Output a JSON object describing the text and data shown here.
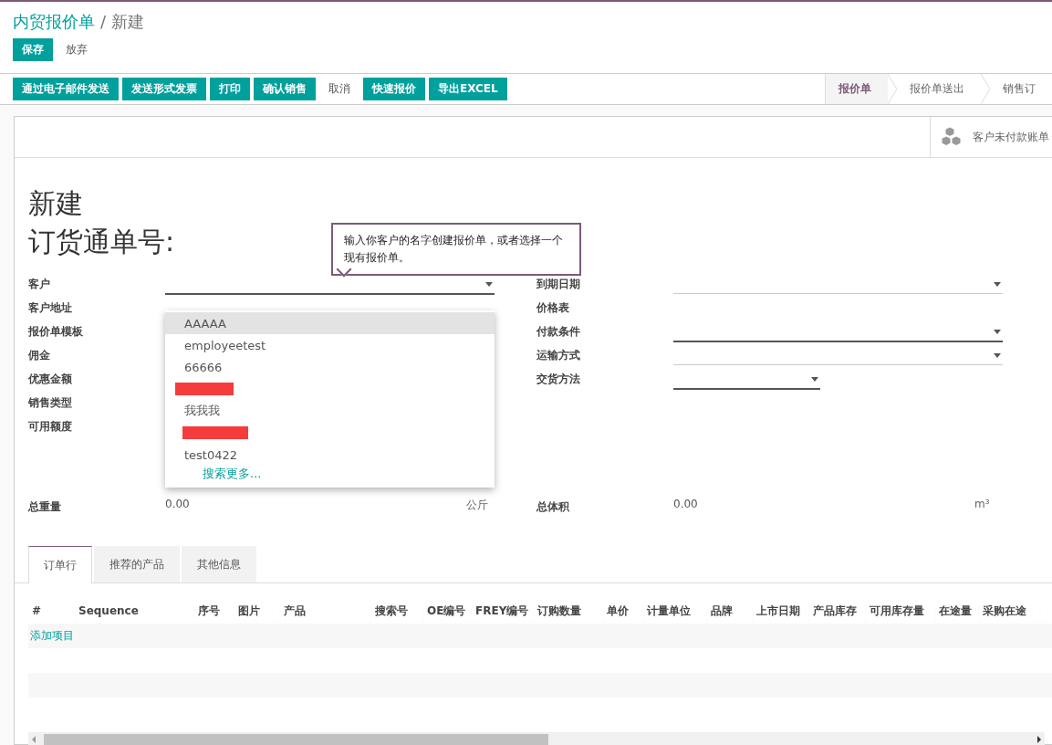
{
  "breadcrumb": {
    "parent": "内贸报价单",
    "separator": "/",
    "current": "新建"
  },
  "edit_buttons": [
    {
      "label": "保存",
      "kind": "primary"
    },
    {
      "label": "放弃",
      "kind": "link"
    }
  ],
  "action_buttons": [
    {
      "label": "通过电子邮件发送",
      "kind": "primary"
    },
    {
      "label": "发送形式发票",
      "kind": "primary"
    },
    {
      "label": "打印",
      "kind": "primary"
    },
    {
      "label": "确认销售",
      "kind": "primary"
    },
    {
      "label": "取消",
      "kind": "link"
    },
    {
      "label": "快速报价",
      "kind": "primary"
    },
    {
      "label": "导出EXCEL",
      "kind": "primary"
    }
  ],
  "status_steps": [
    {
      "label": "报价单",
      "selected": true
    },
    {
      "label": "报价单送出",
      "selected": false
    },
    {
      "label": "销售订",
      "selected": false
    }
  ],
  "stat_button": {
    "label": "客户未付款账单"
  },
  "title": "新建",
  "subtitle": "订货通单号:",
  "tooltip": "输入你客户的名字创建报价单，或者选择一个现有报价单。",
  "left_fields": [
    {
      "label": "客户",
      "kind": "select",
      "required": true
    },
    {
      "label": "客户地址",
      "kind": "none"
    },
    {
      "label": "报价单模板",
      "kind": "none"
    },
    {
      "label": "佣金",
      "kind": "none"
    },
    {
      "label": "优惠金额",
      "kind": "none"
    },
    {
      "label": "销售类型",
      "kind": "none"
    },
    {
      "label": "可用额度",
      "kind": "none"
    }
  ],
  "right_fields": [
    {
      "label": "到期日期",
      "kind": "select",
      "required": false
    },
    {
      "label": "价格表",
      "kind": "none"
    },
    {
      "label": "付款条件",
      "kind": "select",
      "required": true
    },
    {
      "label": "运输方式",
      "kind": "select",
      "required": false
    },
    {
      "label": "交货方法",
      "kind": "short-select",
      "required": true
    }
  ],
  "dropdown": {
    "items": [
      {
        "kind": "text",
        "label": "AAAAA",
        "selected": true
      },
      {
        "kind": "text",
        "label": "employeetest",
        "selected": false
      },
      {
        "kind": "text",
        "label": "66666",
        "selected": false
      },
      {
        "kind": "redacted",
        "selected": false
      },
      {
        "kind": "text",
        "label": "我我我",
        "selected": false
      },
      {
        "kind": "redacted",
        "selected": false
      },
      {
        "kind": "text",
        "label": "test0422",
        "selected": false
      }
    ],
    "more": "搜索更多..."
  },
  "totals": [
    {
      "label": "总重量",
      "value": "0.00",
      "unit": "公斤"
    },
    {
      "label": "总体积",
      "value": "0.00",
      "unit": "m³"
    }
  ],
  "tabs": [
    {
      "label": "订单行",
      "selected": true
    },
    {
      "label": "推荐的产品",
      "selected": false
    },
    {
      "label": "其他信息",
      "selected": false
    }
  ],
  "table": {
    "columns": [
      "#",
      "Sequence",
      "序号",
      "图片",
      "产品",
      "搜索号",
      "OE编号",
      "FREY编号",
      "订购数量",
      "单价",
      "计量单位",
      "品牌",
      "上市日期",
      "产品库存",
      "可用库存量",
      "在途量",
      "采购在途"
    ],
    "add_line": "添加项目"
  }
}
